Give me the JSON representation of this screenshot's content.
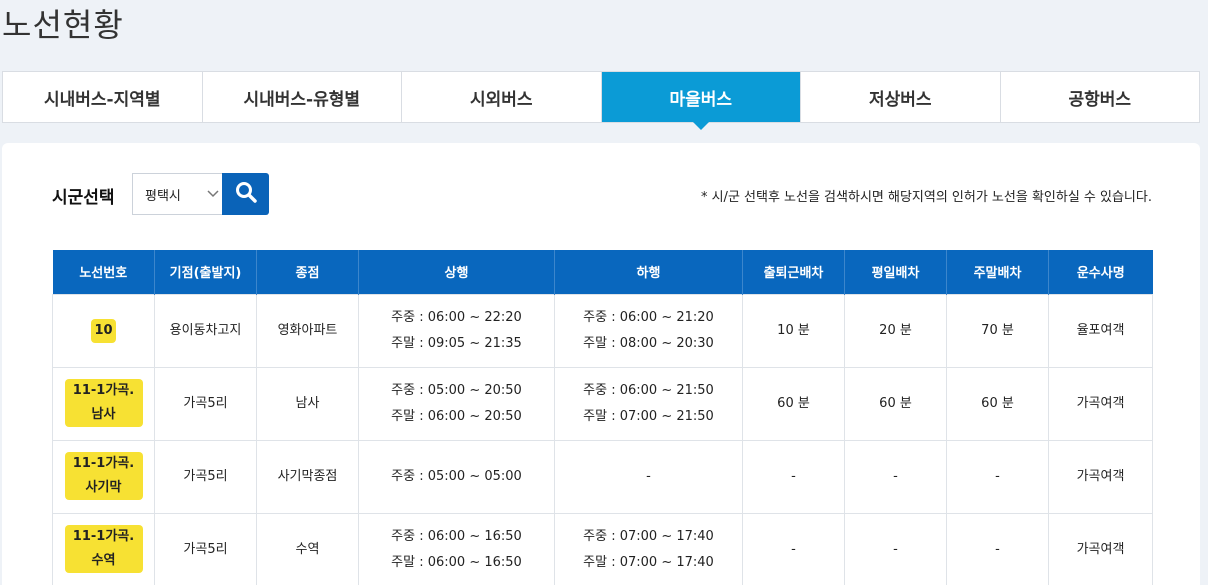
{
  "page_title": "노선현황",
  "tabs": [
    {
      "label": "시내버스-지역별",
      "active": false
    },
    {
      "label": "시내버스-유형별",
      "active": false
    },
    {
      "label": "시외버스",
      "active": false
    },
    {
      "label": "마을버스",
      "active": true
    },
    {
      "label": "저상버스",
      "active": false
    },
    {
      "label": "공항버스",
      "active": false
    }
  ],
  "filter": {
    "label": "시군선택",
    "selected_region": "평택시",
    "notice": "* 시/군 선택후 노선을 검색하시면 해당지역의 인허가 노선을 확인하실 수 있습니다."
  },
  "table": {
    "headers": [
      "노선번호",
      "기점(출발지)",
      "종점",
      "상행",
      "하행",
      "출퇴근배차",
      "평일배차",
      "주말배차",
      "운수사명"
    ],
    "rows": [
      {
        "route": "10",
        "start": "용이동차고지",
        "end": "영화아파트",
        "up1": "주중 : 06:00 ~ 22:20",
        "up2": "주말 : 09:05 ~ 21:35",
        "down1": "주중 : 06:00 ~ 21:20",
        "down2": "주말 : 08:00 ~ 20:30",
        "rush": "10 분",
        "weekday": "20 분",
        "weekend": "70 분",
        "company": "율포여객"
      },
      {
        "route": "11-1가곡.남사",
        "start": "가곡5리",
        "end": "남사",
        "up1": "주중 : 05:00 ~ 20:50",
        "up2": "주말 : 06:00 ~ 20:50",
        "down1": "주중 : 06:00 ~ 21:50",
        "down2": "주말 : 07:00 ~ 21:50",
        "rush": "60 분",
        "weekday": "60 분",
        "weekend": "60 분",
        "company": "가곡여객"
      },
      {
        "route": "11-1가곡.사기막",
        "start": "가곡5리",
        "end": "사기막종점",
        "up1": "주중 : 05:00 ~ 05:00",
        "up2": "",
        "down1": "-",
        "down2": "",
        "rush": "-",
        "weekday": "-",
        "weekend": "-",
        "company": "가곡여객"
      },
      {
        "route": "11-1가곡.수역",
        "start": "가곡5리",
        "end": "수역",
        "up1": "주중 : 06:00 ~ 16:50",
        "up2": "주말 : 06:00 ~ 16:50",
        "down1": "주중 : 07:00 ~ 17:40",
        "down2": "주말 : 07:00 ~ 17:40",
        "rush": "-",
        "weekday": "-",
        "weekend": "-",
        "company": "가곡여객"
      }
    ]
  },
  "colors": {
    "tab_active": "#0b9bd6",
    "header_bg": "#0967be",
    "route_badge": "#f7e133",
    "search_btn": "#0a63b8"
  },
  "icons": {
    "search": "search-icon",
    "select": "chevron-down-icon"
  }
}
